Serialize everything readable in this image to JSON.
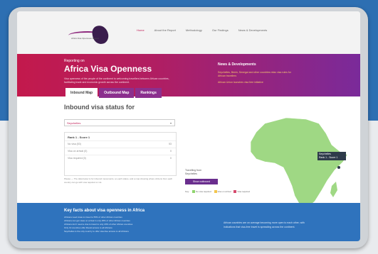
{
  "nav": {
    "logo_text": "Africa Visa Openness Report",
    "links": [
      "Home",
      "About the Report",
      "Methodology",
      "Our Findings",
      "News & Developments"
    ]
  },
  "hero": {
    "pretitle": "Reporting on",
    "title": "Africa Visa Openness",
    "subtitle": "Visa openness of the people of the continent to welcoming travellers between African countries, facilitating trade and economic growth across the continent."
  },
  "news": {
    "title": "News & Developments",
    "items": [
      "Seychelles, Benin, Senegal and other countries relax visa rules for African travellers",
      "African Union launches visa free initiative"
    ]
  },
  "tabs": [
    "Inbound Map",
    "Outbound Map",
    "Rankings"
  ],
  "panel": {
    "heading": "Inbound visa status for",
    "selected_country": "Seychelles",
    "list_header": "Rank 1 - Score 1",
    "rows": [
      {
        "label": "No visa (53)",
        "count": "53"
      },
      {
        "label": "Visa on arrival (0)",
        "count": "0"
      },
      {
        "label": "Visa required (0)",
        "count": "0"
      }
    ],
    "note": "Please — The data below is for inbound movements, so each status, and a map showing where citizens from each country can go with visa required or not."
  },
  "map": {
    "travelling_from_label": "Travelling from",
    "travelling_from_value": "Seychelles",
    "show_button": "Show outbound",
    "key_label": "Key:",
    "key_items": [
      "No visa required",
      "Visa on arrival",
      "Visa required"
    ],
    "tooltip_country": "Seychelles",
    "tooltip_rank": "Rank 1 - Score 1",
    "colors": {
      "no_visa": "#8fd46e",
      "land": "#9fd884",
      "ocean": "#ffffff",
      "selected": "#2e3b4a"
    }
  },
  "footer": {
    "title": "Key facts about visa openness in Africa",
    "bullets": [
      "Africans need visas to travel to 55% of other African countries",
      "Africans can get visas on arrival in only 25% of other African countries",
      "Africans don't need a visa to travel to only 20% of other African countries",
      "Only 13 countries offer liberal access to all Africans",
      "Seychelles is the only country to offer visa-free access to all Africans"
    ],
    "right_text": "African countries are on average becoming more open to each other, with indications that visa-free travel is spreading across the continent."
  }
}
